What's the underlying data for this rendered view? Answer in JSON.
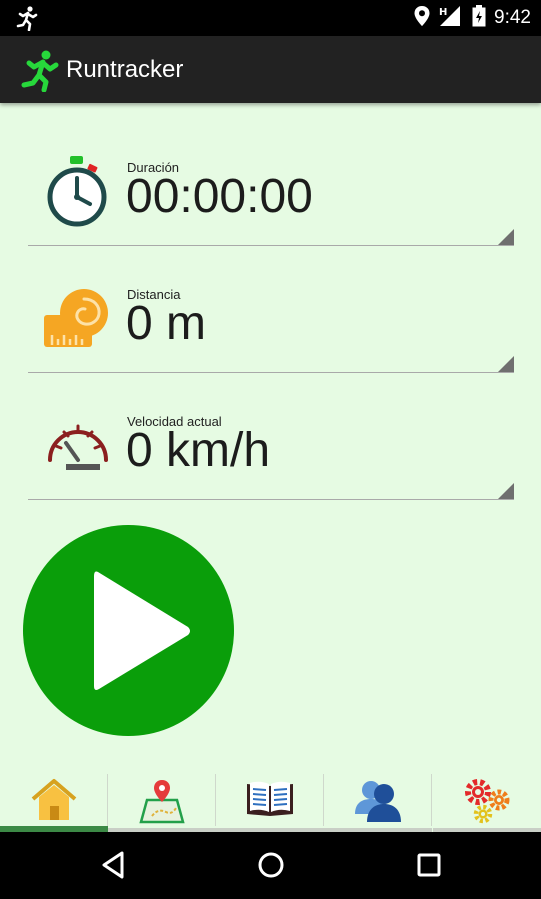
{
  "status_bar": {
    "time": "9:42",
    "icons": [
      "runner-icon",
      "location-icon",
      "signal-icon",
      "battery-icon"
    ]
  },
  "app_bar": {
    "title": "Runtracker",
    "logo_icon": "runner-icon",
    "logo_color": "#27d83b"
  },
  "metrics": [
    {
      "label": "Duración",
      "value": "00:00:00",
      "icon": "stopwatch-icon"
    },
    {
      "label": "Distancia",
      "value": "0 m",
      "icon": "tape-measure-icon"
    },
    {
      "label": "Velocidad actual",
      "value": "0 km/h",
      "icon": "speedometer-icon"
    }
  ],
  "play_button": {
    "icon": "play-icon",
    "color": "#0a9e0a"
  },
  "tabs": [
    {
      "icon": "home-icon",
      "active": true
    },
    {
      "icon": "map-icon",
      "active": false
    },
    {
      "icon": "book-icon",
      "active": false
    },
    {
      "icon": "users-icon",
      "active": false
    },
    {
      "icon": "gears-icon",
      "active": false
    }
  ],
  "nav_bar": {
    "icons": [
      "back-icon",
      "home-circle-icon",
      "recents-icon"
    ]
  },
  "colors": {
    "background": "#e6fbe3",
    "app_bar": "#222222",
    "accent": "#0a9e0a"
  }
}
